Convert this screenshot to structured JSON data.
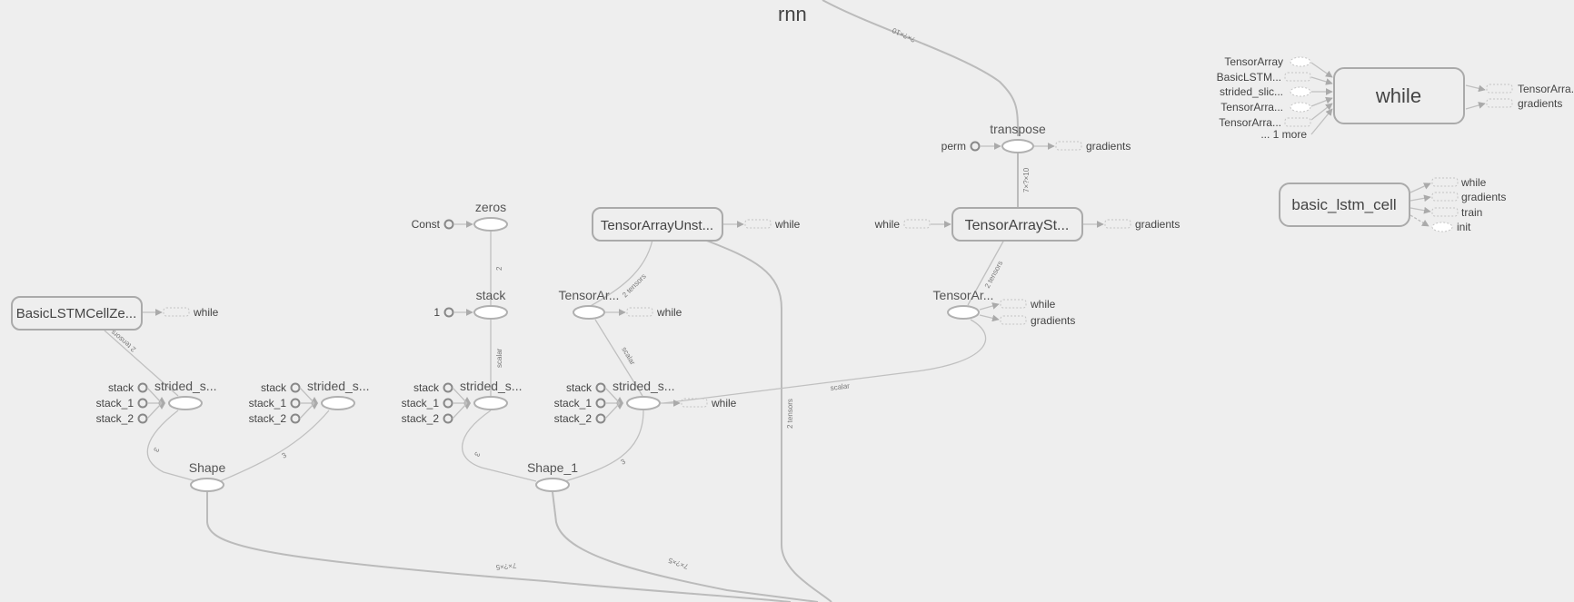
{
  "graph": {
    "title": "rnn",
    "meta_nodes": {
      "while": "while",
      "basic_lstm_cell": "basic_lstm_cell",
      "tensorarray_unstack": "TensorArrayUnst...",
      "tensorarray_stack": "TensorArraySt...",
      "basiclstm_zero_state": "BasicLSTMCellZe..."
    },
    "op_nodes": {
      "transpose": "transpose",
      "zeros": "zeros",
      "stack": "stack",
      "tensorar_left": "TensorAr...",
      "tensorar_right": "TensorAr...",
      "strided_s": "strided_s...",
      "shape": "Shape",
      "shape_1": "Shape_1"
    },
    "const_labels": {
      "perm": "perm",
      "const": "Const",
      "one": "1",
      "stack": "stack",
      "stack_1": "stack_1",
      "stack_2": "stack_2"
    },
    "while_inputs": [
      "TensorArray",
      "BasicLSTM...",
      "strided_slic...",
      "TensorArra...",
      "TensorArra...",
      "... 1 more"
    ],
    "while_outputs": [
      "TensorArra...",
      "gradients"
    ],
    "basic_lstm_cell_outputs": [
      "while",
      "gradients",
      "train",
      "init"
    ],
    "stub_labels": {
      "while": "while",
      "gradients": "gradients"
    },
    "edge_labels": {
      "rnn_to_transpose": "?×?×10",
      "transpose_to_stack": "7×?×10",
      "zeros_to_stack": "2",
      "stack_to_strided": "scalar",
      "unstack_2tensors": "2 tensors",
      "tensorar_scalar": "scalar",
      "stack_2tensors": "2 tensors",
      "right_scalar": "scalar",
      "lstm_2tensors": "2 tensors",
      "three": "3",
      "shape_out": "7×?×5",
      "shape1_out": "7×?×5",
      "unstack_down": "2 tensors"
    }
  }
}
